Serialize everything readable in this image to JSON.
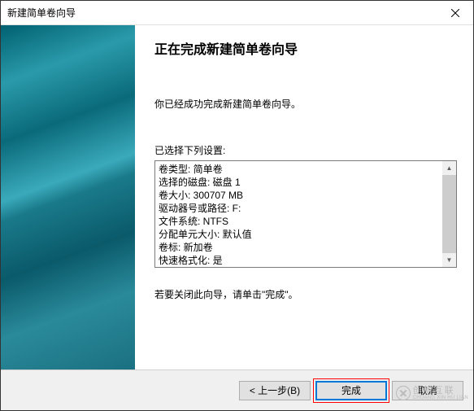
{
  "titlebar": {
    "title": "新建简单卷向导"
  },
  "main": {
    "heading": "正在完成新建简单卷向导",
    "intro": "你已经成功完成新建简单卷向导。",
    "settings_label": "已选择下列设置:",
    "settings": [
      "卷类型: 简单卷",
      "选择的磁盘: 磁盘 1",
      "卷大小: 300707 MB",
      "驱动器号或路径: F:",
      "文件系统: NTFS",
      "分配单元大小: 默认值",
      "卷标: 新加卷",
      "快速格式化: 是"
    ],
    "closing": "若要关闭此向导，请单击\"完成\"。"
  },
  "footer": {
    "back": "< 上一步(B)",
    "finish": "完成",
    "cancel": "取消"
  },
  "watermark": {
    "line1": "创新互联",
    "line2": "CHUANG XIN HU LIAN"
  }
}
